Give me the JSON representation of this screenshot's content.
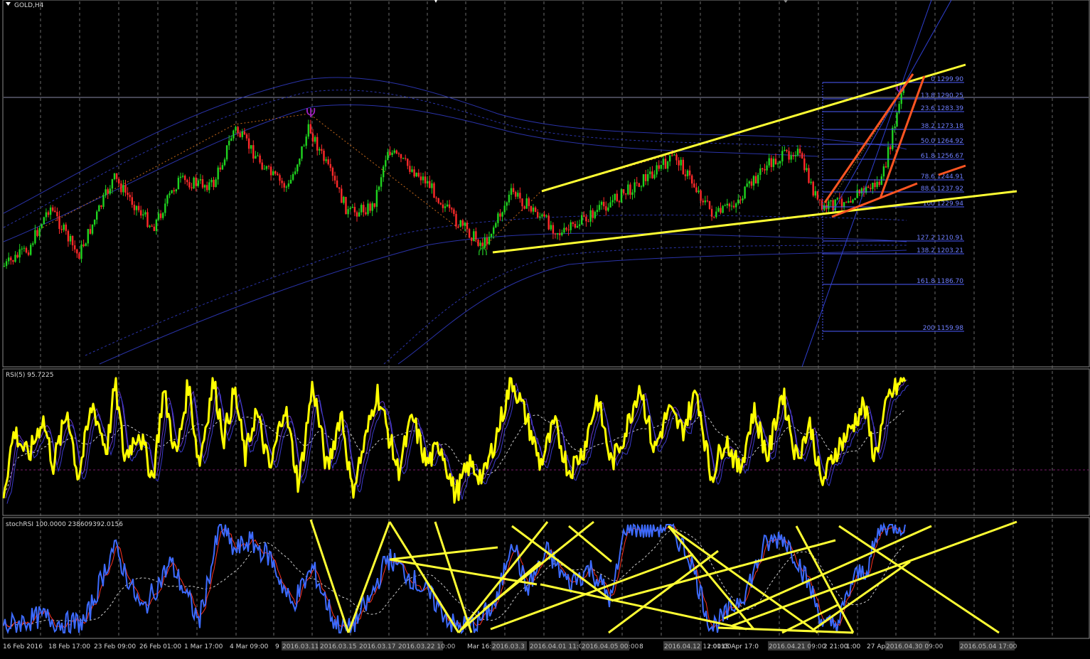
{
  "window": {
    "symbol_title": "GOLD,H4",
    "menu_icon": "triangle-down-icon"
  },
  "colors": {
    "background": "#000000",
    "bull_candle": "#1fd31f",
    "bear_candle": "#ff2a2a",
    "trendline_yellow": "#ffff33",
    "trendline_orange": "#ff5522",
    "fib": "#4d5cff",
    "rsi": "#ffff00",
    "stoch_main": "#3d6bff",
    "stoch_signal": "#ff3322"
  },
  "main_panel": {
    "fib_levels": [
      {
        "label": "0 1299.90",
        "level": 1299.9
      },
      {
        "label": "13.8 1290.25",
        "level": 1290.25
      },
      {
        "label": "23.6 1283.39",
        "level": 1283.39
      },
      {
        "label": "38.2 1273.18",
        "level": 1273.18
      },
      {
        "label": "50.0 1264.92",
        "level": 1264.92
      },
      {
        "label": "61.8 1256.67",
        "level": 1256.67
      },
      {
        "label": "78.6 1244.91",
        "level": 1244.91
      },
      {
        "label": "88.6 1237.92",
        "level": 1237.92
      },
      {
        "label": "100 1229.94",
        "level": 1229.94
      },
      {
        "label": "127.2 1210.91",
        "level": 1210.91
      },
      {
        "label": "138.2 1203.21",
        "level": 1203.21
      },
      {
        "label": "161.8 1186.70",
        "level": 1186.7
      },
      {
        "label": "200 1159.98",
        "level": 1159.98
      }
    ]
  },
  "rsi_panel": {
    "title": "RSI(5) 95.7225",
    "value": 95.7225
  },
  "stoch_panel": {
    "title": "stochRSI 100.0000 238609392.0156",
    "value": 100.0
  },
  "time_axis": {
    "labels": [
      "16 Feb 2016",
      "18 Feb 17:00",
      "23 Feb 09:00",
      "26 Feb 01:00",
      "1 Mar 17:00",
      "4 Mar 09:00",
      "9",
      "Mar 16:0",
      "8",
      "15 Apr 17:0",
      "r 01:00",
      "2 21:00",
      "1:00",
      "27 Ap"
    ],
    "highlight_labels": [
      "2016.03.11",
      "2016.03.15 0",
      "2016.03.17 14:",
      "2016.03.22 10:00",
      "2016.03.3",
      "2016.04.01 11:00",
      "2016.04.05 15:00",
      "00",
      "2016.04.12 12:00",
      "2016.04.21 09:00",
      "2016.04.30 09:00",
      "2016.05.04 17:00"
    ]
  }
}
